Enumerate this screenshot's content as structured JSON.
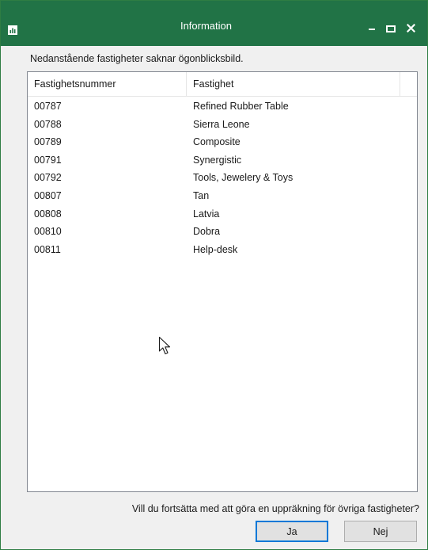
{
  "window": {
    "title": "Information",
    "accent_color": "#217346",
    "icons": {
      "app": "chart-app-icon",
      "minimize": "minimize-icon",
      "maximize": "maximize-icon",
      "close": "close-icon"
    }
  },
  "message": "Nedanstående fastigheter saknar ögonblicksbild.",
  "list": {
    "columns": [
      "Fastighetsnummer",
      "Fastighet",
      ""
    ],
    "rows": [
      {
        "number": "00787",
        "name": "Refined Rubber Table"
      },
      {
        "number": "00788",
        "name": "Sierra Leone"
      },
      {
        "number": "00789",
        "name": "Composite"
      },
      {
        "number": "00791",
        "name": "Synergistic"
      },
      {
        "number": "00792",
        "name": "Tools, Jewelery & Toys"
      },
      {
        "number": "00807",
        "name": "Tan"
      },
      {
        "number": "00808",
        "name": "Latvia"
      },
      {
        "number": "00810",
        "name": "Dobra"
      },
      {
        "number": "00811",
        "name": "Help-desk"
      }
    ]
  },
  "question": "Vill du fortsätta med att göra en uppräkning för övriga fastigheter?",
  "buttons": {
    "yes": "Ja",
    "no": "Nej"
  }
}
